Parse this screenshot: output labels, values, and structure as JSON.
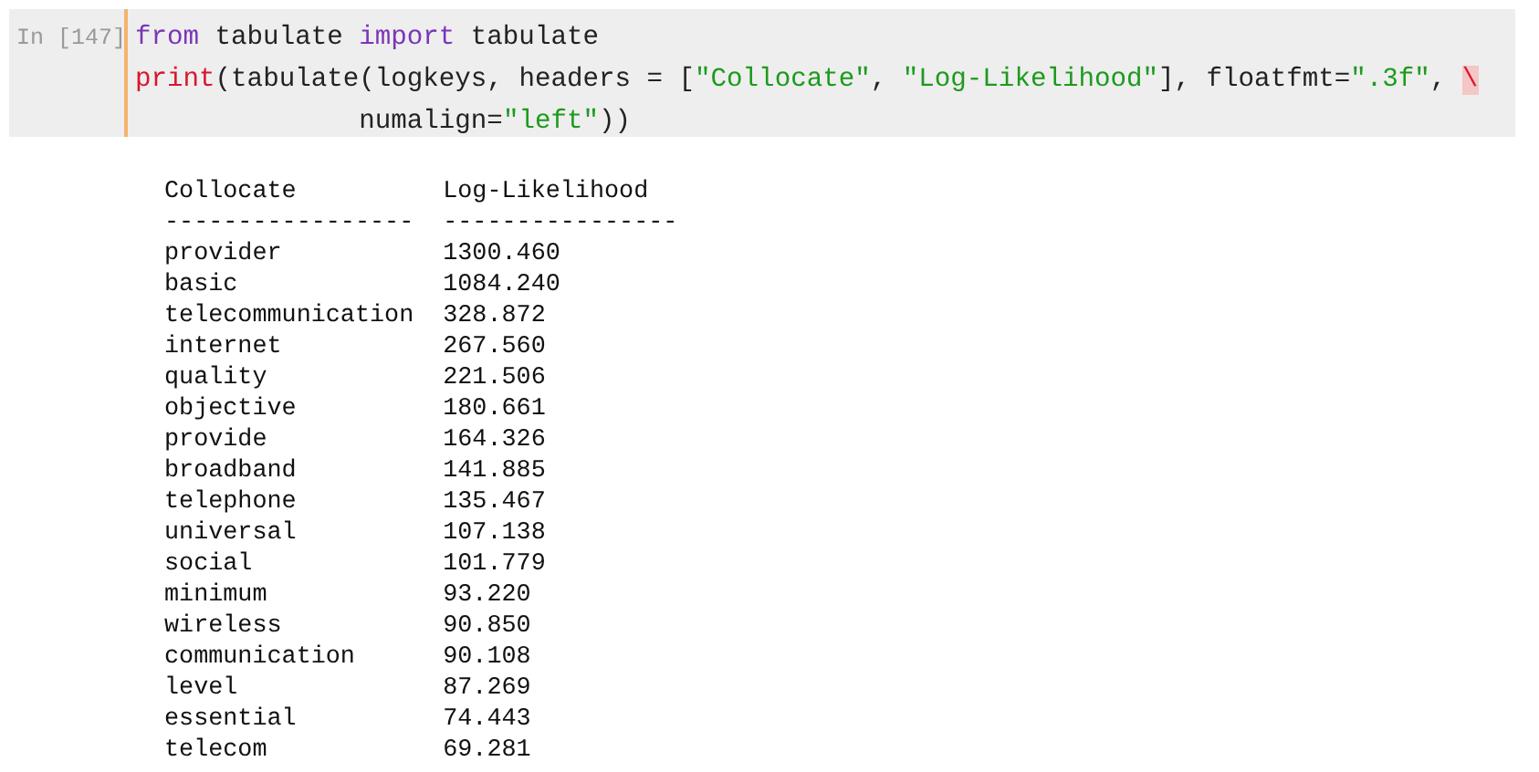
{
  "cell": {
    "prompt": "In [147]",
    "code_lines": [
      [
        {
          "kind": "keyword",
          "text": "from"
        },
        {
          "kind": "plain",
          "text": " tabulate "
        },
        {
          "kind": "keyword",
          "text": "import"
        },
        {
          "kind": "plain",
          "text": " tabulate"
        }
      ],
      [
        {
          "kind": "builtin",
          "text": "print"
        },
        {
          "kind": "plain",
          "text": "(tabulate(logkeys, headers = ["
        },
        {
          "kind": "string",
          "text": "\"Collocate\""
        },
        {
          "kind": "plain",
          "text": ", "
        },
        {
          "kind": "string",
          "text": "\"Log-Likelihood\""
        },
        {
          "kind": "plain",
          "text": "], floatfmt="
        },
        {
          "kind": "string",
          "text": "\".3f\""
        },
        {
          "kind": "plain",
          "text": ", "
        },
        {
          "kind": "error",
          "text": "\\"
        }
      ],
      [
        {
          "kind": "plain",
          "text": "              numalign="
        },
        {
          "kind": "string",
          "text": "\"left\""
        },
        {
          "kind": "plain",
          "text": "))"
        }
      ]
    ]
  },
  "output": {
    "columns": [
      "Collocate",
      "Log-Likelihood"
    ],
    "rules": [
      "-----------------",
      "----------------"
    ],
    "rows": [
      [
        "provider",
        "1300.460"
      ],
      [
        "basic",
        "1084.240"
      ],
      [
        "telecommunication",
        "328.872"
      ],
      [
        "internet",
        "267.560"
      ],
      [
        "quality",
        "221.506"
      ],
      [
        "objective",
        "180.661"
      ],
      [
        "provide",
        "164.326"
      ],
      [
        "broadband",
        "141.885"
      ],
      [
        "telephone",
        "135.467"
      ],
      [
        "universal",
        "107.138"
      ],
      [
        "social",
        "101.779"
      ],
      [
        "minimum",
        "93.220"
      ],
      [
        "wireless",
        "90.850"
      ],
      [
        "communication",
        "90.108"
      ],
      [
        "level",
        "87.269"
      ],
      [
        "essential",
        "74.443"
      ],
      [
        "telecom",
        "69.281"
      ]
    ]
  }
}
